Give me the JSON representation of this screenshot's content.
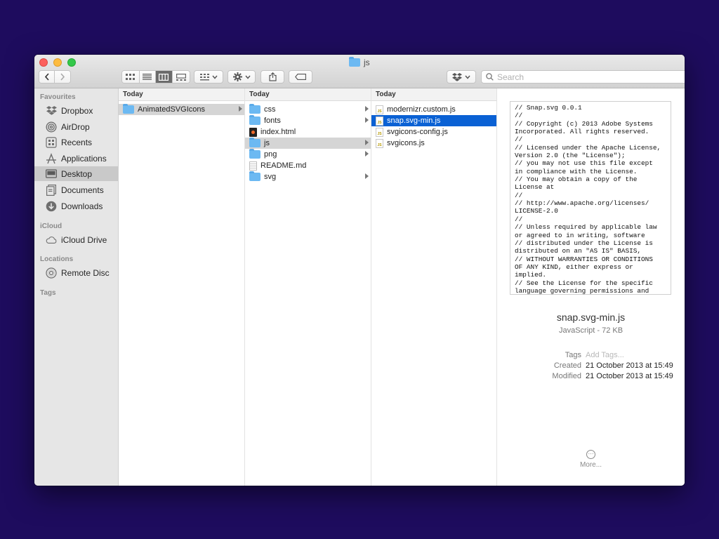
{
  "window": {
    "title": "js"
  },
  "toolbar": {
    "back_icon": "chevron-left",
    "forward_icon": "chevron-right",
    "view_modes": [
      "icon-view",
      "list-view",
      "column-view",
      "gallery-view"
    ],
    "active_view": "column-view",
    "search_placeholder": "Search"
  },
  "sidebar": {
    "favourites_label": "Favourites",
    "favourites": [
      {
        "label": "Dropbox",
        "icon": "dropbox-icon"
      },
      {
        "label": "AirDrop",
        "icon": "airdrop-icon"
      },
      {
        "label": "Recents",
        "icon": "clock-icon"
      },
      {
        "label": "Applications",
        "icon": "applications-icon"
      },
      {
        "label": "Desktop",
        "icon": "desktop-icon",
        "selected": true
      },
      {
        "label": "Documents",
        "icon": "document-icon"
      },
      {
        "label": "Downloads",
        "icon": "download-icon"
      }
    ],
    "icloud_label": "iCloud",
    "icloud": [
      {
        "label": "iCloud Drive",
        "icon": "cloud-icon"
      }
    ],
    "locations_label": "Locations",
    "locations": [
      {
        "label": "Remote Disc",
        "icon": "disc-icon"
      }
    ],
    "tags_label": "Tags"
  },
  "columns": [
    {
      "header": "Today",
      "items": [
        {
          "name": "AnimatedSVGIcons",
          "type": "folder",
          "has_children": true,
          "selected": "grey"
        }
      ]
    },
    {
      "header": "Today",
      "items": [
        {
          "name": "css",
          "type": "folder",
          "has_children": true
        },
        {
          "name": "fonts",
          "type": "folder",
          "has_children": true
        },
        {
          "name": "index.html",
          "type": "html"
        },
        {
          "name": "js",
          "type": "folder",
          "has_children": true,
          "selected": "grey"
        },
        {
          "name": "png",
          "type": "folder",
          "has_children": true
        },
        {
          "name": "README.md",
          "type": "text"
        },
        {
          "name": "svg",
          "type": "folder",
          "has_children": true
        }
      ]
    },
    {
      "header": "Today",
      "items": [
        {
          "name": "modernizr.custom.js",
          "type": "js"
        },
        {
          "name": "snap.svg-min.js",
          "type": "js",
          "selected": "blue"
        },
        {
          "name": "svgicons-config.js",
          "type": "js"
        },
        {
          "name": "svgicons.js",
          "type": "js"
        }
      ]
    }
  ],
  "preview": {
    "code_lines": [
      "// Snap.svg 0.0.1",
      "//",
      "// Copyright (c) 2013 Adobe Systems",
      "Incorporated. All rights reserved.",
      "//",
      "// Licensed under the Apache License,",
      "Version 2.0 (the \"License\");",
      "// you may not use this file except",
      "in compliance with the License.",
      "// You may obtain a copy of the",
      "License at",
      "//",
      "// http://www.apache.org/licenses/",
      "LICENSE-2.0",
      "//",
      "// Unless required by applicable law",
      "or agreed to in writing, software",
      "// distributed under the License is",
      "distributed on an \"AS IS\" BASIS,",
      "// WITHOUT WARRANTIES OR CONDITIONS",
      "OF ANY KIND, either express or",
      "implied.",
      "// See the License for the specific",
      "language governing permissions and"
    ],
    "file_name": "snap.svg-min.js",
    "file_kind": "JavaScript - 72 KB",
    "tags_label": "Tags",
    "tags_placeholder": "Add Tags...",
    "created_label": "Created",
    "created_value": "21 October 2013 at 15:49",
    "modified_label": "Modified",
    "modified_value": "21 October 2013 at 15:49",
    "more_label": "More..."
  },
  "colors": {
    "desktop_bg": "#1e0c5e",
    "selection_blue": "#0a61d4",
    "folder_blue": "#6cb9f2"
  }
}
